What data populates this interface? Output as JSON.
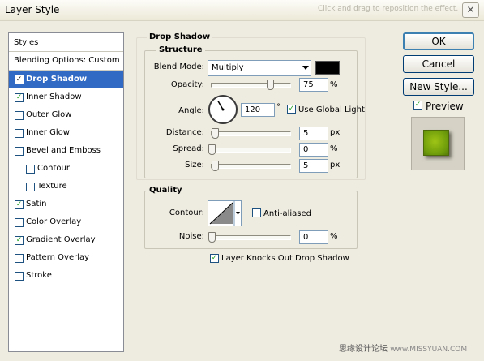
{
  "window": {
    "title": "Layer Style",
    "close_label": "✕",
    "watermark_top": "Click and drag to reposition the effect."
  },
  "styles_panel": {
    "header": "Styles",
    "items": [
      {
        "label": "Blending Options: Custom",
        "checkbox": false
      },
      {
        "label": "Drop Shadow",
        "checkbox": true,
        "checked": "✓",
        "selected": true
      },
      {
        "label": "Inner Shadow",
        "checkbox": true,
        "checked": "✓"
      },
      {
        "label": "Outer Glow",
        "checkbox": true,
        "checked": ""
      },
      {
        "label": "Inner Glow",
        "checkbox": true,
        "checked": ""
      },
      {
        "label": "Bevel and Emboss",
        "checkbox": true,
        "checked": ""
      },
      {
        "label": "Contour",
        "checkbox": true,
        "checked": ""
      },
      {
        "label": "Texture",
        "checkbox": true,
        "checked": ""
      },
      {
        "label": "Satin",
        "checkbox": true,
        "checked": "✓"
      },
      {
        "label": "Color Overlay",
        "checkbox": true,
        "checked": ""
      },
      {
        "label": "Gradient Overlay",
        "checkbox": true,
        "checked": "✓"
      },
      {
        "label": "Pattern Overlay",
        "checkbox": true,
        "checked": ""
      },
      {
        "label": "Stroke",
        "checkbox": true,
        "checked": ""
      }
    ]
  },
  "drop_shadow": {
    "title": "Drop Shadow",
    "structure": {
      "title": "Structure",
      "blend_mode_label": "Blend Mode:",
      "blend_mode_value": "Multiply",
      "shadow_color": "#000000",
      "opacity_label": "Opacity:",
      "opacity_value": "75",
      "opacity_unit": "%",
      "opacity_percent": 75,
      "angle_label": "Angle:",
      "angle_value": "120",
      "angle_unit": "°",
      "use_global_light_label": "Use Global Light",
      "use_global_light_checked": "✓",
      "distance_label": "Distance:",
      "distance_value": "5",
      "distance_unit": "px",
      "spread_label": "Spread:",
      "spread_value": "0",
      "spread_unit": "%",
      "size_label": "Size:",
      "size_value": "5",
      "size_unit": "px"
    },
    "quality": {
      "title": "Quality",
      "contour_label": "Contour:",
      "anti_aliased_label": "Anti-aliased",
      "anti_aliased_checked": "",
      "noise_label": "Noise:",
      "noise_value": "0",
      "noise_unit": "%"
    },
    "knockout_label": "Layer Knocks Out Drop Shadow",
    "knockout_checked": "✓"
  },
  "buttons": {
    "ok": "OK",
    "cancel": "Cancel",
    "new_style": "New Style..."
  },
  "preview": {
    "label": "Preview",
    "checked": "✓",
    "swatch_color": "#8ab512"
  },
  "watermark": {
    "text": "思缘设计论坛",
    "site": "www.MISSYUAN.COM"
  }
}
